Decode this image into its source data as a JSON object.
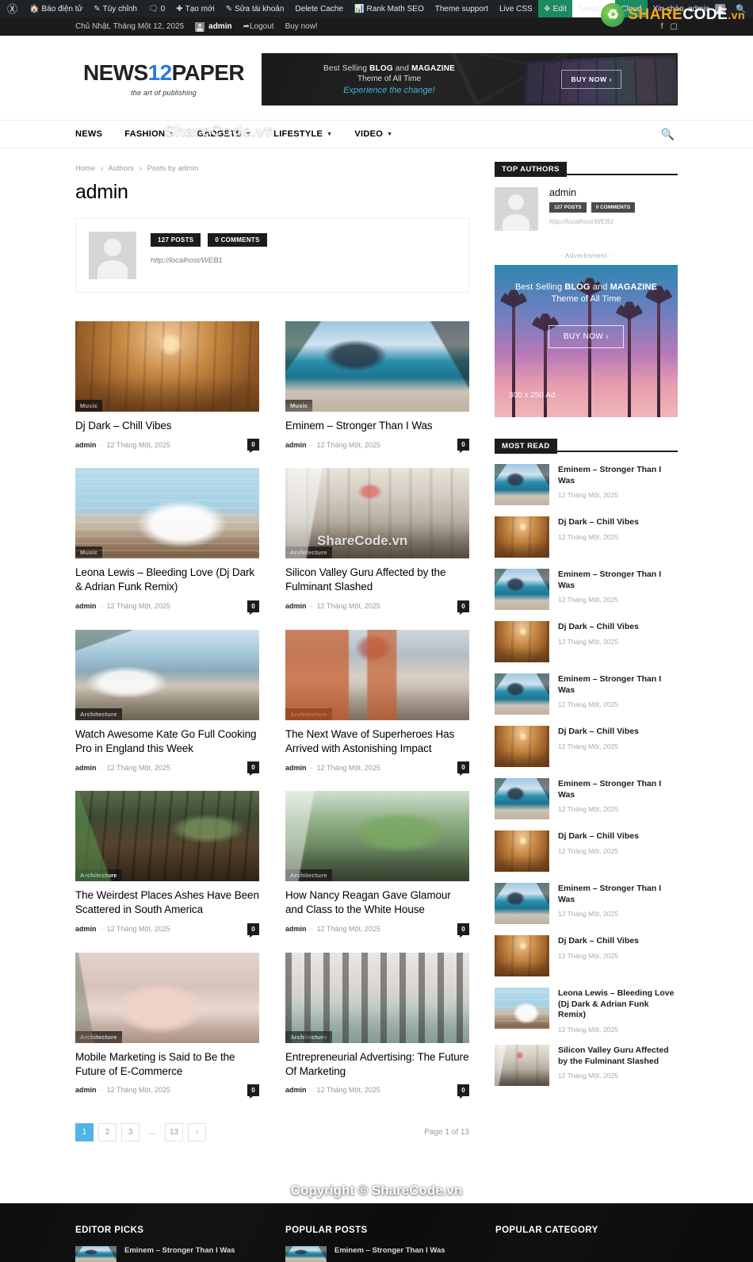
{
  "adminbar": {
    "wp_logo_icon": "wordpress-icon",
    "items": [
      {
        "label": "Báo điện tử",
        "icon": "dashboard-icon"
      },
      {
        "label": "Tùy chỉnh",
        "icon": "pencil-icon"
      },
      {
        "label": "0",
        "icon": "comment-icon"
      },
      {
        "label": "Tạo mới",
        "icon": "plus-icon"
      },
      {
        "label": "Sửa tài khoản",
        "icon": "edit-icon"
      },
      {
        "label": "Delete Cache",
        "icon": ""
      },
      {
        "label": "Rank Math SEO",
        "icon": "chart-icon"
      },
      {
        "label": "Theme support",
        "icon": ""
      },
      {
        "label": "Live CSS",
        "icon": ""
      }
    ],
    "tagdiv_items": [
      {
        "label": "Edit",
        "icon": "tagdiv-icon",
        "style": "green"
      },
      {
        "label": "Template",
        "icon": "",
        "style": "white"
      },
      {
        "label": "Cloud",
        "icon": "",
        "style": "green"
      }
    ],
    "greeting": "Xin chào, admin",
    "search_icon": "search-icon"
  },
  "topbar": {
    "date": "Chủ Nhật, Tháng Một 12, 2025",
    "user": "admin",
    "logout": "Logout",
    "buy_now": "Buy now!",
    "social": [
      "facebook-icon",
      "instagram-icon"
    ]
  },
  "watermark": {
    "brand_share": "SHARE",
    "brand_code": "CODE",
    "brand_vn": ".vn",
    "nav_overlay": "ShareCode.vn",
    "content_overlay": "ShareCode.vn",
    "copyright": "Copyright © ShareCode.vn"
  },
  "logo": {
    "part1": "NEWS",
    "number": "12",
    "part2": "PAPER",
    "tagline": "the art of publishing"
  },
  "header_ad": {
    "line1_pre": "Best Selling ",
    "line1_b1": "BLOG",
    "line1_mid": " and ",
    "line1_b2": "MAGAZINE",
    "line2": "Theme of All Time",
    "line3": "Experience the change!",
    "button": "BUY NOW  ›"
  },
  "nav": {
    "items": [
      {
        "label": "NEWS",
        "has_caret": false
      },
      {
        "label": "FASHION",
        "has_caret": true
      },
      {
        "label": "GADGETS",
        "has_caret": true
      },
      {
        "label": "LIFESTYLE",
        "has_caret": true
      },
      {
        "label": "VIDEO",
        "has_caret": true
      }
    ],
    "search_icon": "search-icon"
  },
  "breadcrumb": {
    "home": "Home",
    "authors": "Authors",
    "current": "Posts by admin",
    "separator": "›"
  },
  "page_title": "admin",
  "author_box": {
    "posts_badge": "127 POSTS",
    "comments_badge": "0 COMMENTS",
    "url": "http://localhost/WEB1"
  },
  "articles": [
    {
      "title": "Dj Dark – Chill Vibes",
      "category": "Music",
      "author": "admin",
      "date": "12 Tháng Một, 2025",
      "comments": "0",
      "img": "img-living"
    },
    {
      "title": "Eminem – Stronger Than I Was",
      "category": "Music",
      "author": "admin",
      "date": "12 Tháng Một, 2025",
      "comments": "0",
      "img": "img-pool"
    },
    {
      "title": "Leona Lewis – Bleeding Love (Dj Dark & Adrian Funk Remix)",
      "category": "Music",
      "author": "admin",
      "date": "12 Tháng Một, 2025",
      "comments": "0",
      "img": "img-sofa"
    },
    {
      "title": "Silicon Valley Guru Affected by the Fulminant Slashed",
      "category": "Architecture",
      "author": "admin",
      "date": "12 Tháng Một, 2025",
      "comments": "0",
      "img": "img-loft"
    },
    {
      "title": "Watch Awesome Kate Go Full Cooking Pro in England this Week",
      "category": "Architecture",
      "author": "admin",
      "date": "12 Tháng Một, 2025",
      "comments": "0",
      "img": "img-lake"
    },
    {
      "title": "The Next Wave of Superheroes Has Arrived with Astonishing Impact",
      "category": "Architecture",
      "author": "admin",
      "date": "12 Tháng Một, 2025",
      "comments": "0",
      "img": "img-bedroom"
    },
    {
      "title": "The Weirdest Places Ashes Have Been Scattered in South America",
      "category": "Architecture",
      "author": "admin",
      "date": "12 Tháng Một, 2025",
      "comments": "0",
      "img": "img-jungle"
    },
    {
      "title": "How Nancy Reagan Gave Glamour and Class to the White House",
      "category": "Architecture",
      "author": "admin",
      "date": "12 Tháng Một, 2025",
      "comments": "0",
      "img": "img-plants"
    },
    {
      "title": "Mobile Marketing is Said to Be the Future of E-Commerce",
      "category": "Architecture",
      "author": "admin",
      "date": "12 Tháng Một, 2025",
      "comments": "0",
      "img": "img-bath"
    },
    {
      "title": "Entrepreneurial Advertising: The Future Of Marketing",
      "category": "Architecture",
      "author": "admin",
      "date": "12 Tháng Một, 2025",
      "comments": "0",
      "img": "img-gallery"
    }
  ],
  "pagination": {
    "pages": [
      "1",
      "2",
      "3",
      "…",
      "13"
    ],
    "next_icon": "›",
    "active": "1",
    "info": "Page 1 of 13"
  },
  "sidebar": {
    "top_authors": {
      "title": "TOP AUTHORS",
      "name": "admin",
      "posts_badge": "127 POSTS",
      "comments_badge": "0 COMMENTS",
      "url": "http://localhost/WEB1"
    },
    "ad": {
      "label": "- Advertisment -",
      "line1_pre": "Best Selling ",
      "line1_b1": "BLOG",
      "line1_mid": " and ",
      "line1_b2": "MAGAZINE",
      "line2": "Theme of All Time",
      "button": "BUY NOW  ›",
      "size": "300 x 250 Ad"
    },
    "most_read": {
      "title": "MOST READ",
      "items": [
        {
          "title": "Eminem – Stronger Than I Was",
          "date": "12 Tháng Một, 2025",
          "img": "img-pool"
        },
        {
          "title": "Dj Dark – Chill Vibes",
          "date": "12 Tháng Một, 2025",
          "img": "img-living"
        },
        {
          "title": "Eminem – Stronger Than I Was",
          "date": "12 Tháng Một, 2025",
          "img": "img-pool"
        },
        {
          "title": "Dj Dark – Chill Vibes",
          "date": "12 Tháng Một, 2025",
          "img": "img-living"
        },
        {
          "title": "Eminem – Stronger Than I Was",
          "date": "12 Tháng Một, 2025",
          "img": "img-pool"
        },
        {
          "title": "Dj Dark – Chill Vibes",
          "date": "12 Tháng Một, 2025",
          "img": "img-living"
        },
        {
          "title": "Eminem – Stronger Than I Was",
          "date": "12 Tháng Một, 2025",
          "img": "img-pool"
        },
        {
          "title": "Dj Dark – Chill Vibes",
          "date": "12 Tháng Một, 2025",
          "img": "img-living"
        },
        {
          "title": "Eminem – Stronger Than I Was",
          "date": "12 Tháng Một, 2025",
          "img": "img-pool"
        },
        {
          "title": "Dj Dark – Chill Vibes",
          "date": "12 Tháng Một, 2025",
          "img": "img-living"
        },
        {
          "title": "Leona Lewis – Bleeding Love (Dj Dark & Adrian Funk Remix)",
          "date": "12 Tháng Một, 2025",
          "img": "img-sofa"
        },
        {
          "title": "Silicon Valley Guru Affected by the Fulminant Slashed",
          "date": "12 Tháng Một, 2025",
          "img": "img-loft"
        }
      ]
    }
  },
  "footer": {
    "columns": [
      {
        "title": "EDITOR PICKS",
        "item_title": "Eminem – Stronger Than I Was"
      },
      {
        "title": "POPULAR POSTS",
        "item_title": "Eminem – Stronger Than I Was"
      },
      {
        "title": "POPULAR CATEGORY",
        "item_title": ""
      }
    ]
  },
  "colors": {
    "accent": "#50b4e8",
    "dark": "#1c1c1c",
    "adminbar": "#1d2327",
    "green": "#1e8a62",
    "logo_blue": "#2a7ae2"
  }
}
